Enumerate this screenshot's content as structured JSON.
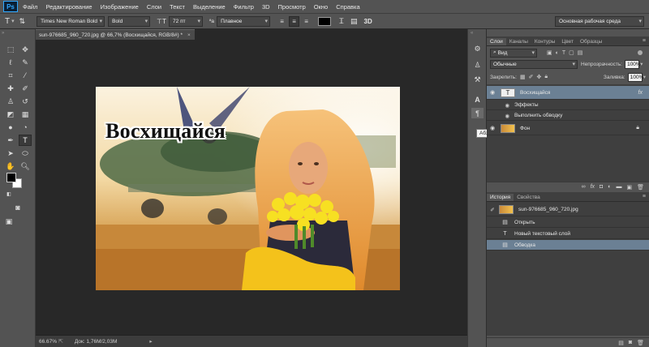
{
  "app": {
    "logo": "Ps",
    "menu": [
      "Файл",
      "Редактирование",
      "Изображение",
      "Слои",
      "Текст",
      "Выделение",
      "Фильтр",
      "3D",
      "Просмотр",
      "Окно",
      "Справка"
    ]
  },
  "options_bar": {
    "font_family": "Times New Roman Bold",
    "font_style": "Bold",
    "font_size": "72 пт",
    "antialias": "Плавное",
    "text_color": "#000000",
    "workspace": "Основная рабочая среда",
    "icons": [
      "text-tool-icon",
      "orientation-icon",
      "font-size-icon",
      "aa-icon",
      "align-left-icon",
      "align-center-icon",
      "align-right-icon",
      "warp-text-icon",
      "panels-icon",
      "3d-icon"
    ]
  },
  "document": {
    "tab_title": "sun-976685_960_720.jpg @ 66,7% (Восхищайся, RGB/8#) *",
    "headline": "Восхищайся"
  },
  "status_bar": {
    "zoom": "66.67%",
    "doc_size": "Док: 1,76М/2,03М"
  },
  "tooltip": "Абзац",
  "layers_panel": {
    "tabs": [
      "Слои",
      "Каналы",
      "Контуры",
      "Цвет",
      "Образцы"
    ],
    "filter": "Вид",
    "blend_mode": "Обычные",
    "opacity_label": "Непрозрачность:",
    "opacity_value": "100%",
    "lock_label": "Закрепить:",
    "fill_label": "Заливка:",
    "fill_value": "100%",
    "layers": [
      {
        "name": "Восхищайся",
        "type": "text",
        "fx": "fx"
      },
      {
        "name": "Эффекты",
        "type": "effects"
      },
      {
        "name": "Выполнить обводку",
        "type": "effect"
      },
      {
        "name": "Фон",
        "type": "image"
      }
    ]
  },
  "history_panel": {
    "tabs": [
      "История",
      "Свойства"
    ],
    "snapshot": "sun-976685_960_720.jpg",
    "items": [
      "Открыть",
      "Новый текстовый слой",
      "Обводка"
    ]
  }
}
